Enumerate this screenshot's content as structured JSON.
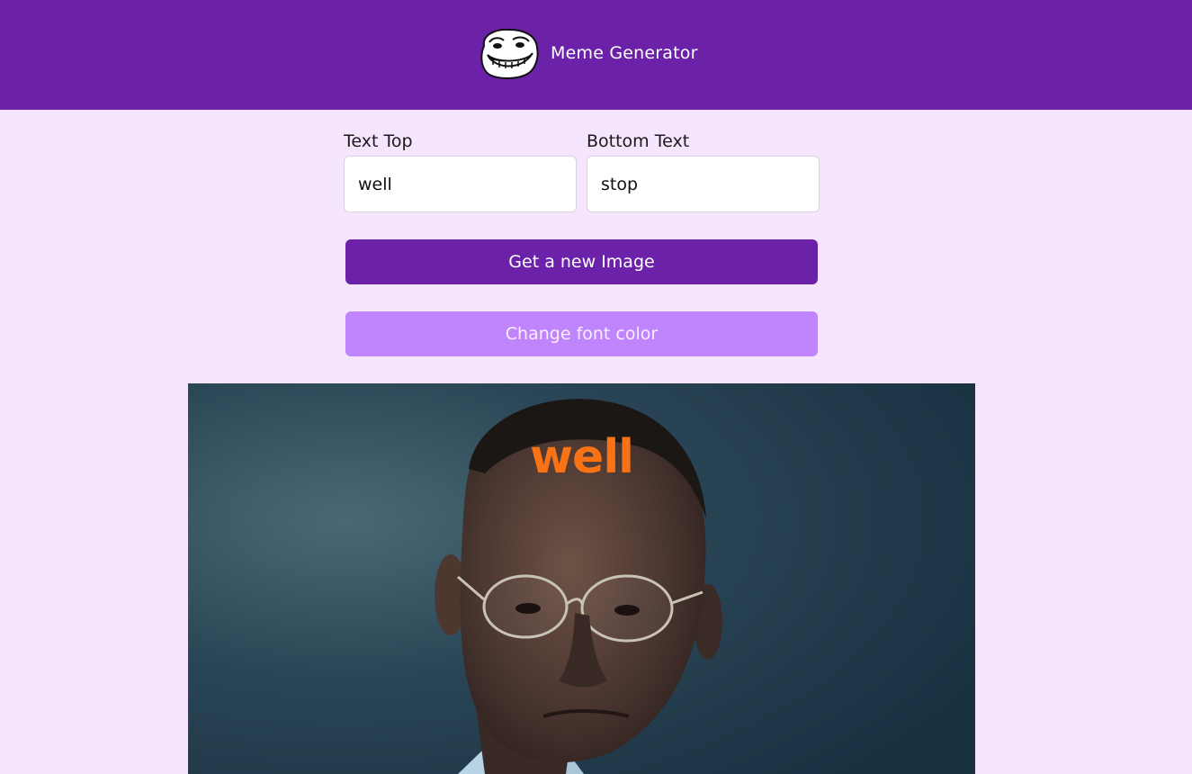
{
  "header": {
    "logo_icon": "trollface-icon",
    "title": "Meme Generator",
    "bg_color": "#6b21a8"
  },
  "form": {
    "top_label": "Text Top",
    "top_value": "well",
    "bottom_label": "Bottom Text",
    "bottom_value": "stop"
  },
  "buttons": {
    "new_image": "Get a new Image",
    "change_color": "Change font color"
  },
  "meme": {
    "top_text": "well",
    "font_color": "#f97316"
  }
}
